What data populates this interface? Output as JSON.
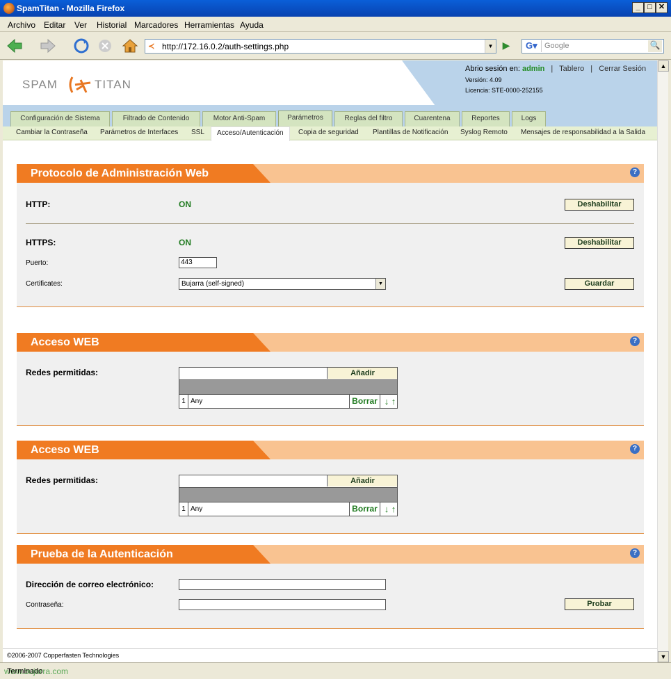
{
  "window": {
    "title": "SpamTitan - Mozilla Firefox"
  },
  "menubar": [
    "Archivo",
    "Editar",
    "Ver",
    "Historial",
    "Marcadores",
    "Herramientas",
    "Ayuda"
  ],
  "browser": {
    "url": "http://172.16.0.2/auth-settings.php",
    "search_placeholder": "Google",
    "status": "Terminado",
    "watermark": "www.bujarra.com"
  },
  "header": {
    "logo_left": "SPAM",
    "logo_right": "TITAN",
    "session_prefix": "Abrio sesión en:",
    "user": "admin",
    "sep": "|",
    "dashboard": "Tablero",
    "logout": "Cerrar Sesión",
    "version": "Versión: 4.09",
    "license": "Licencia: STE-0000-252155"
  },
  "tabs": [
    "Configuración de Sistema",
    "Filtrado de Contenido",
    "Motor Anti-Spam",
    "Parámetros",
    "Reglas del filtro",
    "Cuarentena",
    "Reportes",
    "Logs"
  ],
  "subtabs": [
    "Cambiar la Contraseña",
    "Parámetros de Interfaces",
    "SSL",
    "Acceso/Autenticación",
    "Copia de seguridad",
    "Plantillas de Notificación",
    "Syslog Remoto",
    "Mensajes de responsabilidad a la Salida"
  ],
  "admin_protocol": {
    "title": "Protocolo de Administración Web",
    "http_label": "HTTP:",
    "http_state": "ON",
    "http_button": "Deshabilitar",
    "https_label": "HTTPS:",
    "https_state": "ON",
    "https_button": "Deshabilitar",
    "port_label": "Puerto:",
    "port_value": "443",
    "cert_label": "Certificates:",
    "cert_value": "Bujarra (self-signed)",
    "save_button": "Guardar"
  },
  "web_access_1": {
    "title": "Acceso WEB",
    "label": "Redes permitidas:",
    "add_button": "Añadir",
    "rows": [
      {
        "num": "1",
        "value": "Any",
        "delete": "Borrar",
        "order": "↓ ↑"
      }
    ]
  },
  "web_access_2": {
    "title": "Acceso WEB",
    "label": "Redes permitidas:",
    "add_button": "Añadir",
    "rows": [
      {
        "num": "1",
        "value": "Any",
        "delete": "Borrar",
        "order": "↓ ↑"
      }
    ]
  },
  "auth_test": {
    "title": "Prueba de la Autenticación",
    "email_label": "Dirección de correo electrónico:",
    "password_label": "Contraseña:",
    "test_button": "Probar"
  },
  "help_glyph": "?",
  "footer": "©2006-2007 Copperfasten Technologies"
}
